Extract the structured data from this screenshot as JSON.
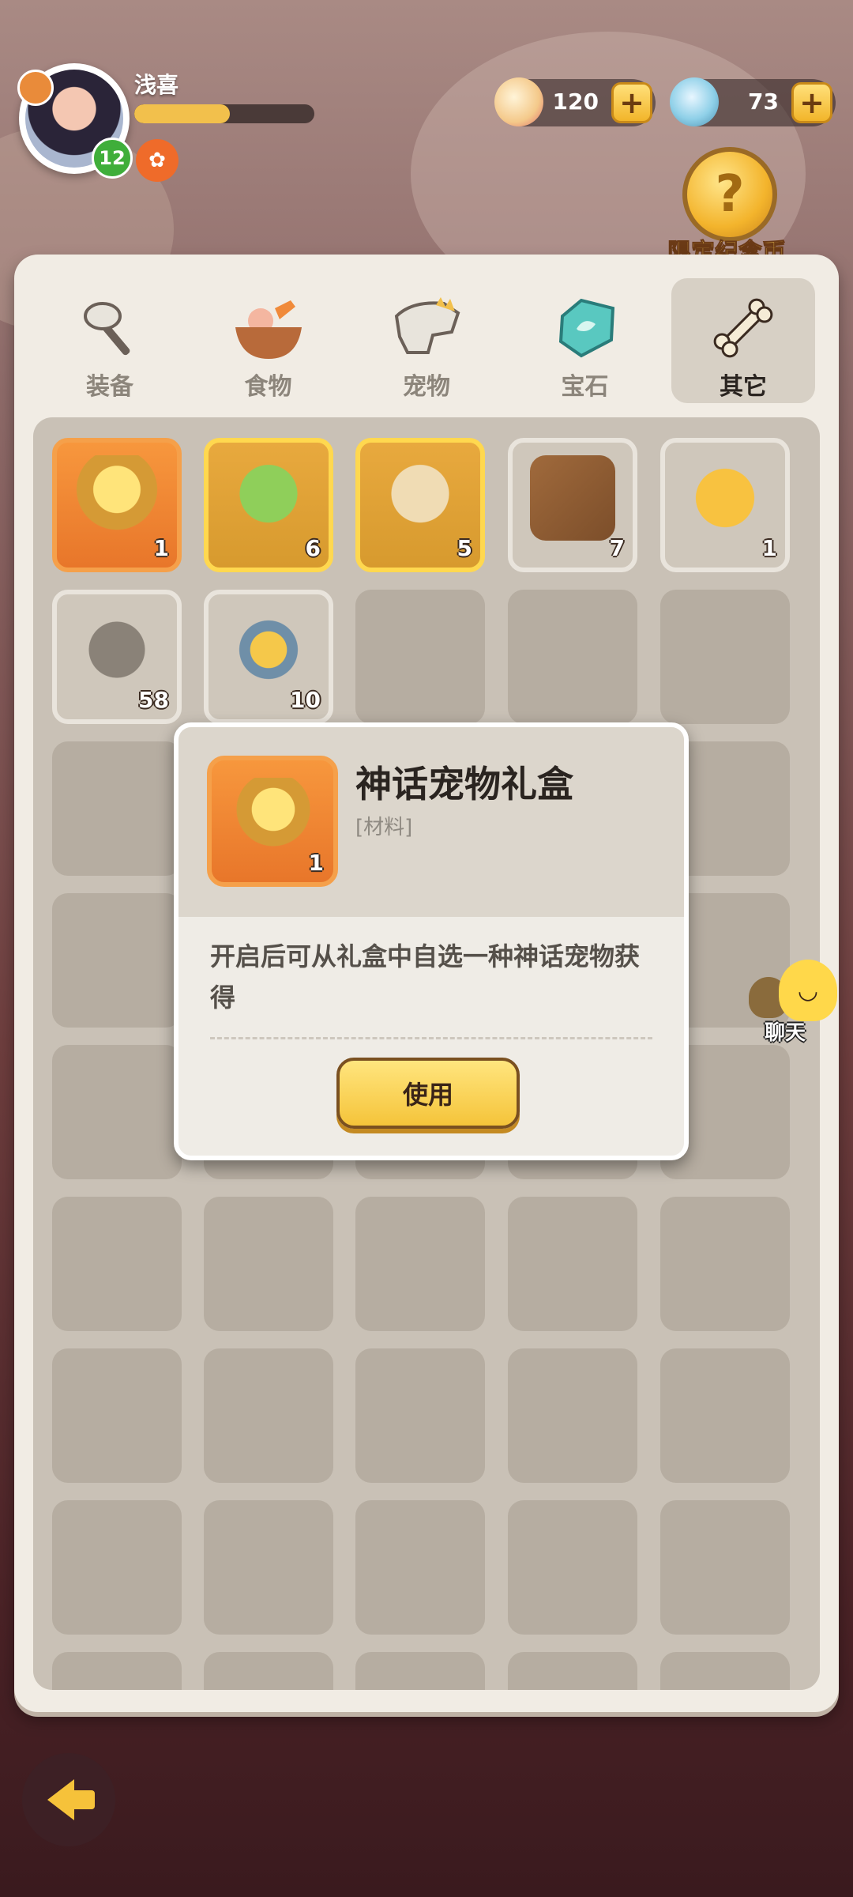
{
  "player": {
    "name": "浅喜",
    "level": "12",
    "exp_fraction": 0.53
  },
  "currencies": [
    {
      "icon": "shell-icon",
      "value": "120"
    },
    {
      "icon": "diamond-icon",
      "value": "73"
    }
  ],
  "limited_coin": {
    "label": "限定纪念币",
    "icon": "question-coin-icon"
  },
  "tabs": [
    {
      "label": "装备",
      "icon": "stone-axe-icon"
    },
    {
      "label": "食物",
      "icon": "food-bowl-icon"
    },
    {
      "label": "宠物",
      "icon": "dino-skull-icon"
    },
    {
      "label": "宝石",
      "icon": "gem-icon"
    },
    {
      "label": "其它",
      "icon": "bone-icon",
      "active": true
    }
  ],
  "items": [
    {
      "name": "mythic-pet-giftbox",
      "qty": "1",
      "rarity": "orange"
    },
    {
      "name": "green-golem-statue",
      "qty": "6",
      "rarity": "gold"
    },
    {
      "name": "stone-lion-statue",
      "qty": "5",
      "rarity": "gold"
    },
    {
      "name": "video-scroll",
      "qty": "7",
      "rarity": "common"
    },
    {
      "name": "gold-shell-coin",
      "qty": "1",
      "rarity": "common"
    },
    {
      "name": "rune-stone",
      "qty": "58",
      "rarity": "common"
    },
    {
      "name": "forge-anvil",
      "qty": "10",
      "rarity": "common"
    }
  ],
  "popup": {
    "title": "神话宠物礼盒",
    "type": "[材料]",
    "qty": "1",
    "description": "开启后可从礼盒中自选一种神话宠物获得",
    "use_label": "使用"
  },
  "chat": {
    "label": "聊天"
  },
  "colors": {
    "accent": "#f5c43a",
    "panel": "#f1ece4",
    "rarity_orange": "#e8762a",
    "rarity_gold": "#ffd84f"
  }
}
